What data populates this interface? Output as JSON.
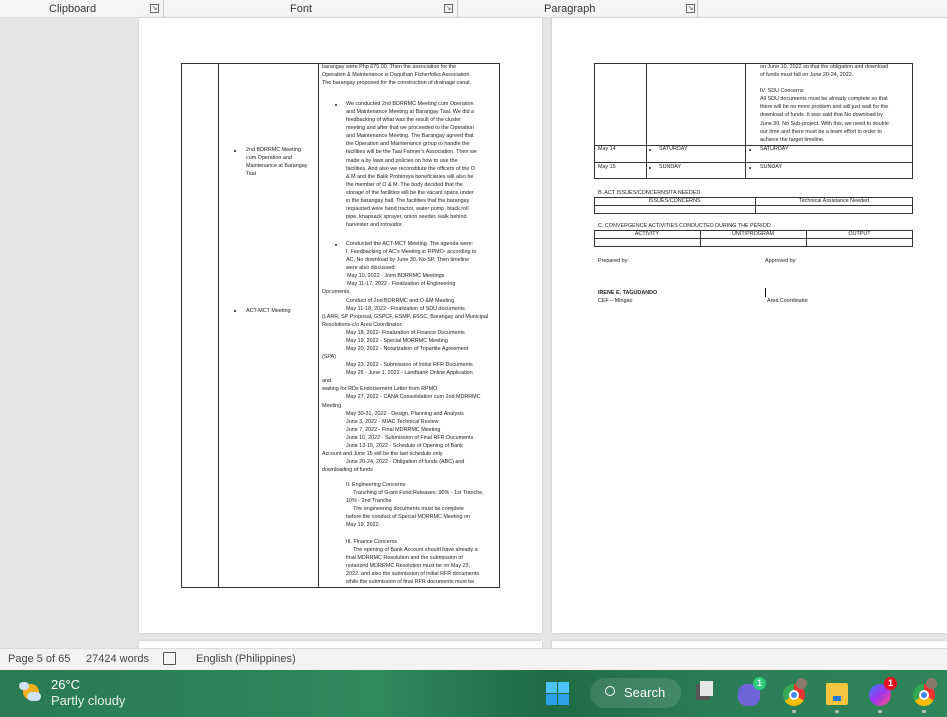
{
  "ribbon": {
    "groups": [
      "Clipboard",
      "Font",
      "Paragraph"
    ],
    "launcher_icon": "dialog-launcher-icon"
  },
  "left_page": {
    "col2": {
      "item1": [
        "2nd BDRRMC Meeting",
        "cum Operation and",
        "Maintenance at Barangay",
        "Taal"
      ],
      "item2": "ACT-MCT Meeting"
    },
    "col3": {
      "intro": [
        "barangay were Php 675.00. Then the association for the",
        "Operation & Maintenance is Daquihan Fisherfolks Association.",
        "The barangay proposed for the construction of drainage canal."
      ],
      "bullet1": [
        "We conducted 2nd BDRRMC Meeting cum Operation",
        "and Maintenance Meeting at Barangay Taal. We did a",
        "feedbacking of what was the result of the cluster",
        "meeting and after that we proceeded to the Operation",
        "and Maintenance Meeting. The Barangay agreed that",
        "the Operation and Maintenance group to handle the",
        "facilities will be the Taal Farmer's Association. Then we",
        "made a by laws and policies on how to use the",
        "facilities. And also we reconstitute the officers of the O",
        "& M and the Balik Probinsya beneficiaries will also be",
        "the member of O & M. The body decided that the",
        "storage of the facilities will be the vacant space under",
        "in the barangay hall. The facilities that the barangay",
        "requested were hand tractor, water pump, black roll",
        "pipe, knapsack sprayer, onion seeder, walk behind",
        "harvester and rotovator."
      ],
      "bullet2": [
        "Conducted the ACT-MCT Meeting. The agenda were:",
        "I. Feedbacking of AC's Meeting in RPMO- according to",
        "AC, No download by June 30, No SP. Then timeline",
        "were also discussed:",
        "May 10, 2022 - Joint BDRRMC Meetings",
        "May 11-17, 2022 - Finalization of Engineering",
        "Documents,",
        "Conduct of 2nd BDRRMC and O &M Meeting",
        "May 11-18, 2022 - Finalization of SDU documents",
        "(LARR, SP Proposal, GSPCF, ESMP, ESSC, Barangay and Municipal",
        "Resolutions-c/o Area Coordinator.",
        "May 18, 2022- Finalization of Finance Documents",
        "May 19, 2022 - Special MDRRMC Meeting",
        "May 20, 2022 - Notarization of Tripartite Agreement",
        "(SPA)",
        "May 23, 2022 - Submission of Initial RFR Documents",
        "May 26 - June 1, 2022 - Landbank Online Application",
        "and",
        "waiting for RDs Endorsement Letter from RPMO",
        "May 27, 2022 - CANA Consolidation cum 2nd MDRRMC",
        "Meeting",
        "May 30-31, 2022 - Design, Planning and Analysis",
        "June 3, 2022 - MIAC Technical Review",
        "June 7, 2022 - Final MDRRMC Meeting",
        "June 10, 2022 - Submission of Final RFR Documents",
        "June 13-15, 2022 - Schedule of Opening of Bank",
        "Account and June 15 will be the last schedule only.",
        "June 20-24, 2022 - Obligation of funds (ABC) and",
        "downloading of funds"
      ],
      "concerns": [
        "II. Engineering Concerns",
        "Tranching of Grant Fund Releases: 90% - 1st Tranche,",
        "10% - 2nd Tranche",
        "The engineering documents must be complete",
        "before the conduct of Special MDRRMC Meeting on",
        "May 19, 2022.",
        "",
        "III. Finance Concerns",
        "The opening of Bank Account should have already a",
        "final MDRRMC Resolution and the submission of",
        "notarized MDRRMC Resolution must be on May 23,",
        "2022. and also the submission of initial RFR documents",
        "while the submission of final RFR documents must be"
      ]
    }
  },
  "right_page": {
    "continued": [
      "on June 10, 2022 so that the obligation and download",
      "of funds must fall on June 20-24, 2022.",
      "",
      "IV. SDU Concerns",
      " All SDU documents must be already complete so that",
      "there will be no more problem and will just wait for the",
      "download of funds. It was said that No download by",
      "June 30, No Sub-project. With this, we need to double",
      "our time and there must be a team effort in order to",
      "achieve the target timeline."
    ],
    "rows": [
      {
        "date": "May 14",
        "col2": "SATURDAY",
        "col3": "SATURDAY"
      },
      {
        "date": "May 15",
        "col2": "SUNDAY",
        "col3": "SUNDAY"
      }
    ],
    "section_b": {
      "title": "B. ACT ISSUES/CONCERNS/TA NEEDED",
      "headers": [
        "ISSUES/CONCERNS",
        "Technical Assistance Needed"
      ]
    },
    "section_c": {
      "title": "C. CONVERGENCE ACTIVITIES CONDUCTED DURING THE PERIOD",
      "headers": [
        "ACTIVITY",
        "UNIT/PROGRAM",
        "OUTPUT"
      ]
    },
    "prepared_by": "Prepared by:",
    "approved_by": "Approved by:",
    "preparer_name": "IRENE E. TAGUDANDO",
    "preparer_title": "CEF – Mingao",
    "approver_title": "Area Coordinator"
  },
  "status_bar": {
    "page": "Page 5 of 65",
    "words": "27424 words",
    "proofing_icon": "proofing-book-icon",
    "language": "English (Philippines)"
  },
  "taskbar": {
    "weather_temp": "26°C",
    "weather_desc": "Partly cloudy",
    "search_label": "Search",
    "badges": {
      "teams": "1",
      "messenger": "1"
    },
    "icons": [
      "windows-start-icon",
      "task-view-icon",
      "teams-icon",
      "chrome-icon",
      "file-explorer-icon",
      "messenger-icon",
      "chrome-profile-icon"
    ]
  }
}
